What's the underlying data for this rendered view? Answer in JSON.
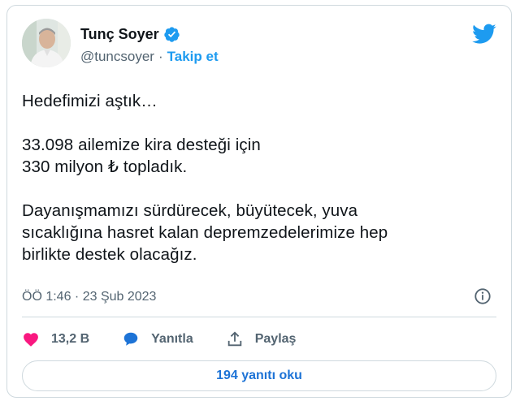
{
  "author": {
    "name": "Tunç Soyer",
    "handle": "@tuncsoyer",
    "separator": "·",
    "follow_label": "Takip et"
  },
  "tweet": {
    "paragraphs": [
      [
        "Hedefimizi aştık…"
      ],
      [
        "33.098 ailemize kira desteği için",
        "330 milyon ₺ topladık."
      ],
      [
        "Dayanışmamızı sürdürecek, büyütecek, yuva",
        "sıcaklığına hasret kalan depremzedelerimize hep",
        "birlikte destek olacağız."
      ]
    ],
    "timestamp": "ÖÖ 1:46 · 23 Şub 2023"
  },
  "actions": {
    "likes": "13,2 B",
    "reply_label": "Yanıtla",
    "share_label": "Paylaş"
  },
  "read_replies_label": "194 yanıtı oku",
  "colors": {
    "twitter_blue": "#1d9bf0",
    "like_pink": "#f91880",
    "text_primary": "#0f1419",
    "text_secondary": "#536471",
    "border": "#cfd9de"
  },
  "icons": [
    "verified-badge-icon",
    "twitter-bird-icon",
    "info-icon",
    "heart-icon",
    "reply-bubble-icon",
    "share-upload-icon"
  ]
}
